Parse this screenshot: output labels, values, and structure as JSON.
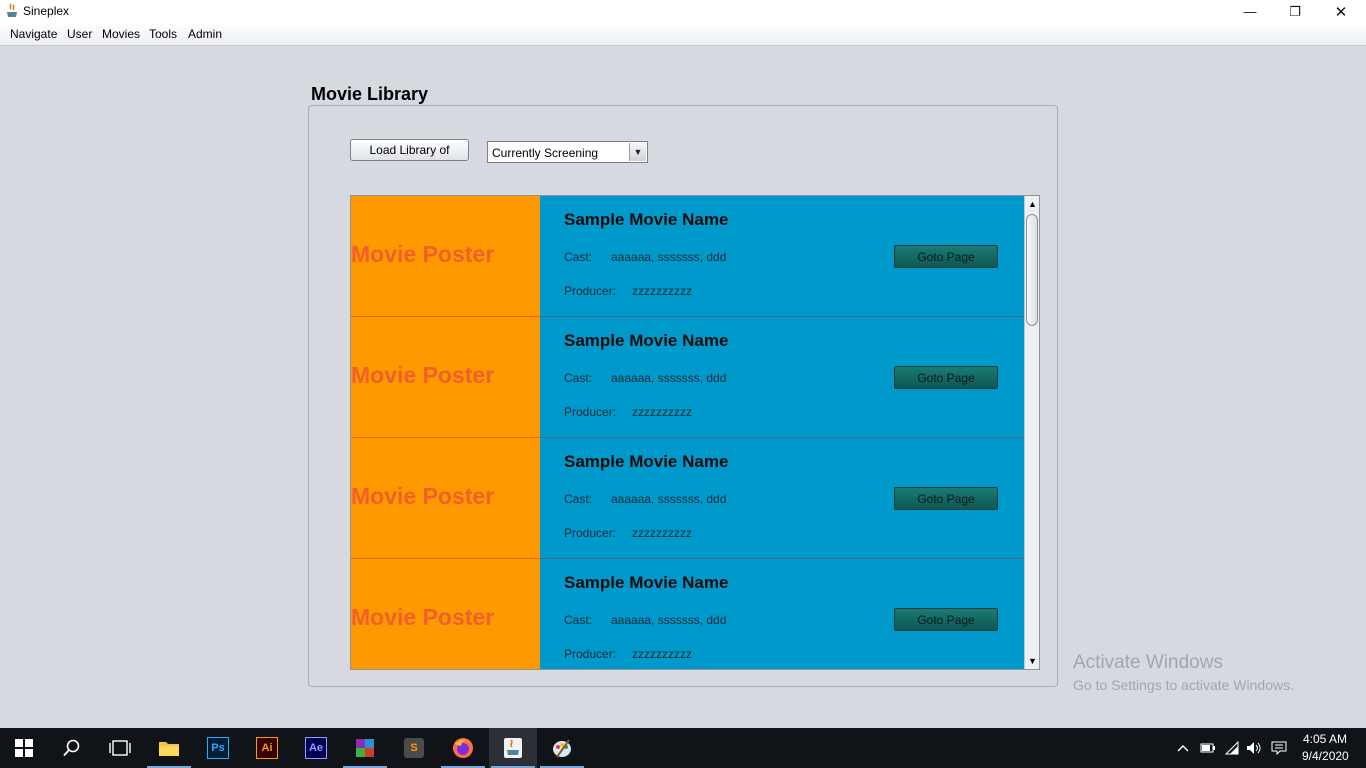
{
  "window": {
    "title": "Sineplex",
    "minimize": "—",
    "maximize": "❐",
    "close": "✕"
  },
  "menu": {
    "items": [
      "Navigate",
      "User",
      "Movies",
      "Tools",
      "Admin"
    ]
  },
  "panel": {
    "title": "Movie Library",
    "load_button": "Load Library of",
    "filter": {
      "selected": "Currently Screening",
      "arrow": "▼"
    }
  },
  "movies": [
    {
      "poster": "Movie Poster",
      "name": "Sample Movie Name",
      "cast_label": "Cast:",
      "cast": "aaaaaa, sssssss, ddd",
      "producer_label": "Producer:",
      "producer": "zzzzzzzzzz",
      "button": "Goto Page"
    },
    {
      "poster": "Movie Poster",
      "name": "Sample Movie Name",
      "cast_label": "Cast:",
      "cast": "aaaaaa, sssssss, ddd",
      "producer_label": "Producer:",
      "producer": "zzzzzzzzzz",
      "button": "Goto Page"
    },
    {
      "poster": "Movie Poster",
      "name": "Sample Movie Name",
      "cast_label": "Cast:",
      "cast": "aaaaaa, sssssss, ddd",
      "producer_label": "Producer:",
      "producer": "zzzzzzzzzz",
      "button": "Goto Page"
    },
    {
      "poster": "Movie Poster",
      "name": "Sample Movie Name",
      "cast_label": "Cast:",
      "cast": "aaaaaa, sssssss, ddd",
      "producer_label": "Producer:",
      "producer": "zzzzzzzzzz",
      "button": "Goto Page"
    }
  ],
  "scrollbar": {
    "up": "▲",
    "down": "▼"
  },
  "watermark": {
    "title": "Activate Windows",
    "subtitle": "Go to Settings to activate Windows."
  },
  "taskbar": {
    "apps": [
      "windows-start",
      "search",
      "task-view",
      "file-explorer",
      "photoshop",
      "illustrator",
      "after-effects",
      "winrar",
      "sublime-text",
      "firefox",
      "java",
      "paint"
    ],
    "app_labels": {
      "photoshop": "Ps",
      "illustrator": "Ai",
      "after_effects": "Ae",
      "sublime": "S"
    },
    "clock": {
      "time": "4:05 AM",
      "date": "9/4/2020"
    }
  },
  "colors": {
    "poster_bg": "#ff9900",
    "poster_text": "#f2602a",
    "info_bg": "#0099cc",
    "goto_button": "#1b7a74",
    "window_bg": "#d6d9e0"
  }
}
